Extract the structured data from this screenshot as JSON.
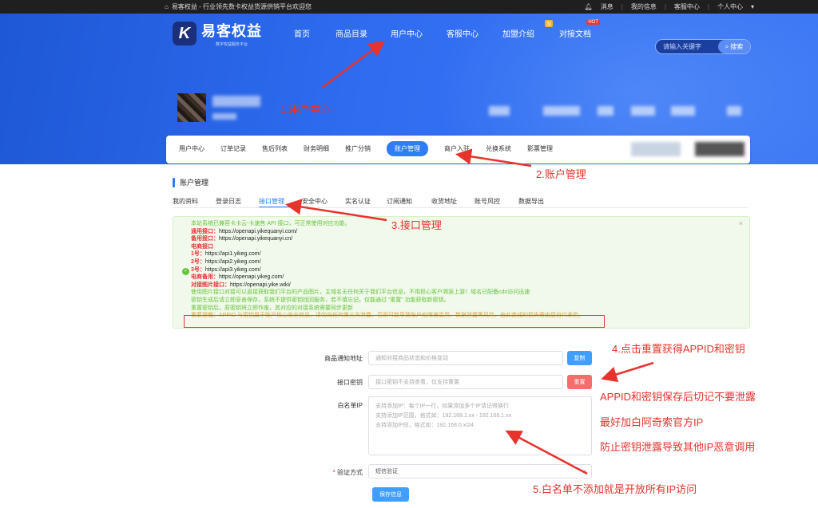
{
  "topbar": {
    "site_text": "易客权益 - 行业领先数卡权益货源供销平台欢迎您",
    "right_items": [
      "消息",
      "我的信息",
      "客服中心",
      "个人中心"
    ]
  },
  "header": {
    "logo_mark": "K",
    "logo_title": "易客权益",
    "logo_subtitle": "数字权益服务平台",
    "nav": [
      {
        "label": "首页"
      },
      {
        "label": "商品目录"
      },
      {
        "label": "用户中心"
      },
      {
        "label": "客服中心"
      },
      {
        "label": "加盟介绍",
        "tag": "加"
      },
      {
        "label": "对接文档",
        "tag": "HOT"
      }
    ],
    "search_placeholder": "请输入关键字",
    "search_button": "搜索"
  },
  "main_tabs": [
    "用户中心",
    "订单记录",
    "售后列表",
    "财务明细",
    "推广分销",
    "账户管理",
    "商户入驻",
    "兑换系统",
    "影票管理"
  ],
  "active_main_tab": "账户管理",
  "panel": {
    "title": "账户管理",
    "subtabs": [
      "我的资料",
      "登录日志",
      "接口管理",
      "安全中心",
      "实名认证",
      "订阅通知",
      "收货地址",
      "账号风控",
      "数据导出"
    ],
    "active_subtab": "接口管理"
  },
  "notice": {
    "intro": "本站系统已兼容卡卡云-卡速售 API 接口，可正常使用对应功能。",
    "general_label": "通用接口：",
    "general_url": "https://openapi.yikequanyi.com/",
    "backup_label": "备用接口：",
    "backup_url": "https://openapi.yikequanyi.cn/",
    "telecom_label": "电商接口",
    "no1_label": "1号：",
    "no1_url": "https://api1.yikeg.com/",
    "no2_label": "2号：",
    "no2_url": "https://api2.yikeg.com/",
    "no3_label": "3号：",
    "no3_url": "https://api3.yikeg.com/",
    "telecom_backup_label": "电商备用：",
    "telecom_backup_url": "https://openapi.yikeg.com/",
    "image_label": "对接图片接口：",
    "image_url": "https://openapi.yike.wiki/",
    "p1": "使用图片接口对接可以直接获取我们平台的产品图片，主域名无任何关于我们平台信息，不用担心客户溯源上游！域名已配备cdn访问迅速",
    "p2": "密钥生成后请立即妥善保存，系统不提供密钥找回服务，若不慎忘记，仅能通过 “重置” 功能获取新密钥。",
    "p3": "重置密钥后，原密钥将立即作废，其对应的对接系统需要同步更新",
    "important": "重要提醒：APPID 与密钥属于账户核心安全信息，请勿向任何第三方泄露，否则可能导致账户权限被滥用、数据泄露等风险，由此造成的损失需由您自行承担。"
  },
  "form": {
    "notify_label": "商品通知地址",
    "notify_placeholder": "通知对接商品状态和价格变动",
    "copy_button": "复制",
    "key_label": "接口密钥",
    "key_placeholder": "接口密钥不支持查看，仅支持重置",
    "reset_button": "重置",
    "whitelist_label": "白名单IP",
    "whitelist_hints": [
      "支持添加IP：每个IP一行，如果添加多个IP请记得换行",
      "支持添加IP范围，格式如：192.168.1.xx - 192.168.1.xx",
      "支持添加IP段，格式如：192.168.0.x/24"
    ],
    "verify_label": "验证方式",
    "verify_value": "短信验证",
    "save_button": "保存信息"
  },
  "annotations": {
    "a1": "1.用户中心",
    "a2": "2.账户管理",
    "a3": "3.接口管理",
    "a4": "4.点击重置获得APPID和密钥",
    "a5a": "APPID和密钥保存后切记不要泄露",
    "a5b": "最好加白阿奇索官方IP",
    "a5c": "防止密钥泄露导致其他IP恶意调用",
    "a6": "5.白名单不添加就是开放所有IP访问"
  },
  "colors": {
    "primary": "#2f7cf6",
    "annotation": "#e8322c",
    "notice_bg": "#f0f9eb",
    "hero": "#2a64e8"
  }
}
